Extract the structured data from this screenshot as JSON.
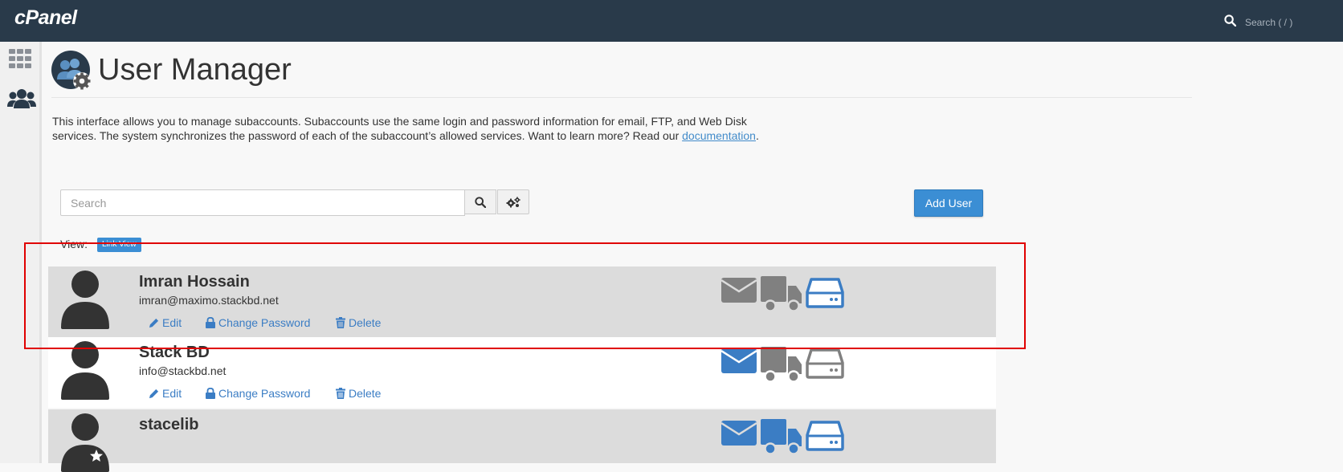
{
  "app": {
    "logo": "cPanel"
  },
  "top_search": {
    "placeholder": "Search ( / )"
  },
  "page": {
    "title": "User Manager",
    "description_text": "This interface allows you to manage subaccounts. Subaccounts use the same login and password information for email, FTP, and Web Disk services. The system synchronizes the password of each of the subaccount’s allowed services. Want to learn more? Read our",
    "doc_link": "documentation",
    "description_end": "."
  },
  "search": {
    "placeholder": "Search"
  },
  "add_user_label": "Add User",
  "view": {
    "label": "View:",
    "mode": "Link View"
  },
  "action_labels": {
    "edit": "Edit",
    "change_password": "Change Password",
    "delete": "Delete"
  },
  "users": [
    {
      "name": "Imran Hossain",
      "email": "imran@maximo.stackbd.net",
      "services": {
        "email": "gray",
        "ftp": "gray",
        "webdisk": "blue"
      }
    },
    {
      "name": "Stack BD",
      "email": "info@stackbd.net",
      "services": {
        "email": "blue",
        "ftp": "gray",
        "webdisk": "gray"
      }
    },
    {
      "name": "stacelib",
      "email": "",
      "services": {
        "email": "blue",
        "ftp": "blue",
        "webdisk": "blue"
      }
    }
  ],
  "colors": {
    "header_bg": "#293a4a",
    "accent_blue": "#3b8ed4",
    "link_blue": "#3b7dc4",
    "service_gray": "#808080",
    "highlight_red": "#e00000"
  },
  "icons": [
    "search-icon",
    "grid-icon",
    "users-icon",
    "user-manager-icon",
    "gear-icon",
    "pencil-icon",
    "lock-icon",
    "trash-icon",
    "envelope-icon",
    "truck-icon",
    "hdd-icon",
    "star-icon"
  ]
}
